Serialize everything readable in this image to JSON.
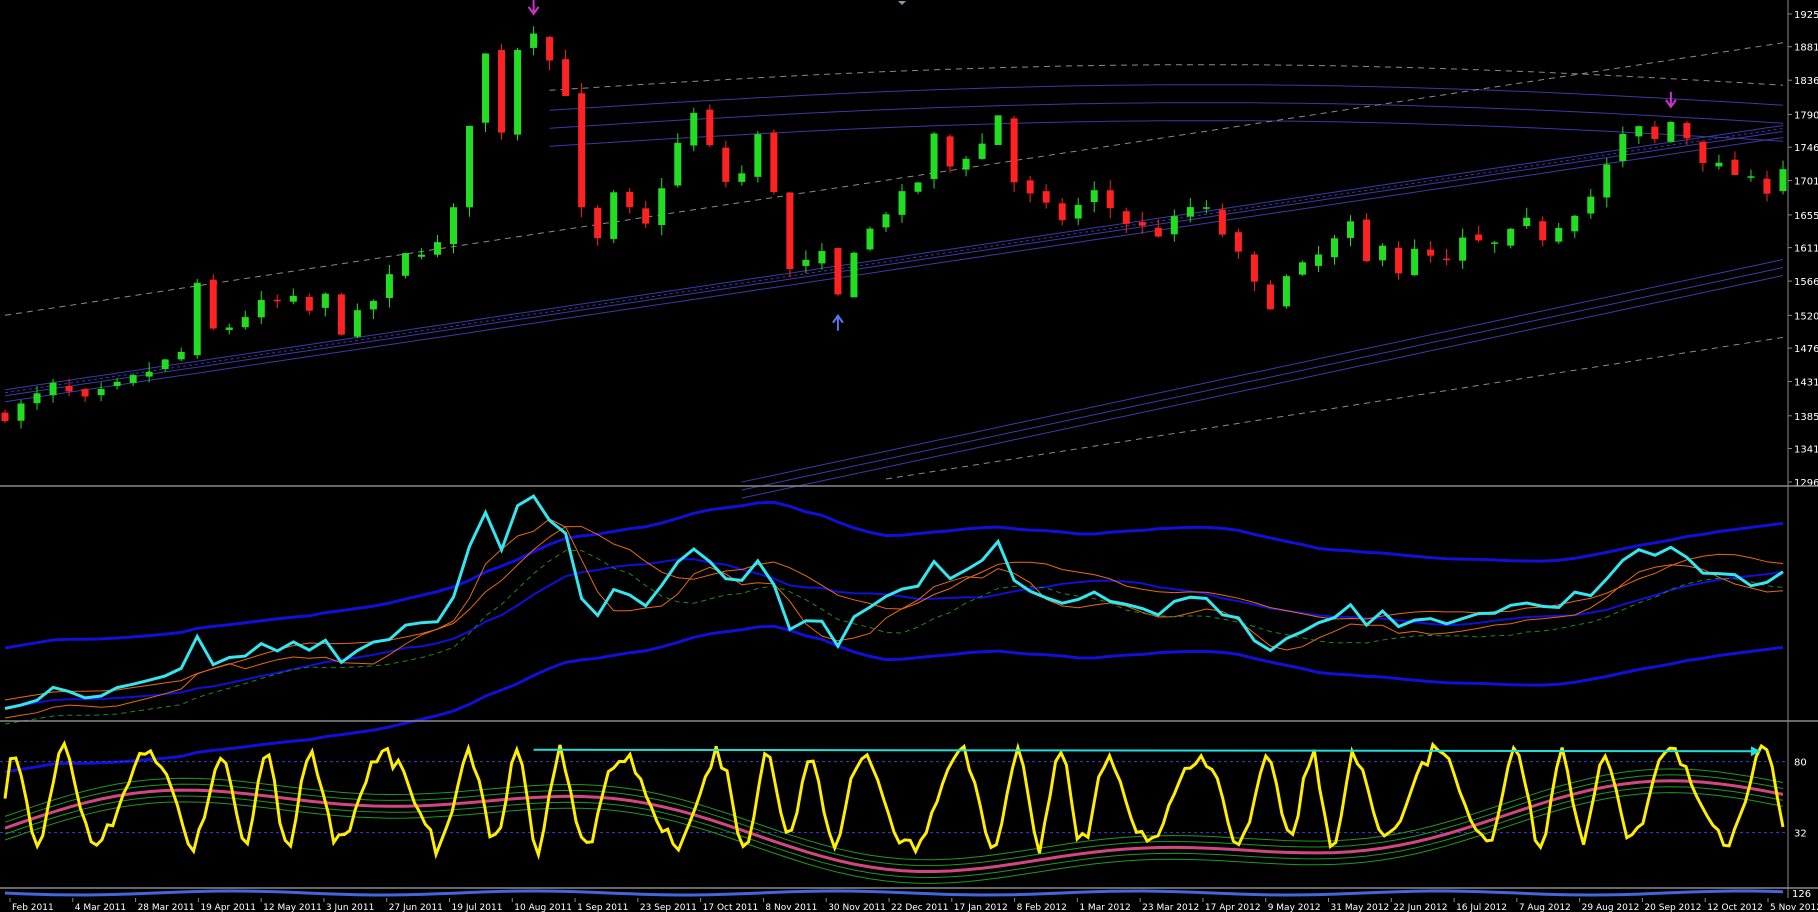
{
  "colors": {
    "background": "#000000",
    "separator": "#8a8a8a",
    "bull": "#22dd22",
    "bear": "#ff2222",
    "channel": "#3a3aa8",
    "channel_dark": "#2a2a80",
    "dash": "#8a8a8a",
    "osc_blue": "#1010d8",
    "osc_cyan": "#33e6f0",
    "osc_orange": "#e86a10",
    "osc_green": "#1e8a1e",
    "rsi_yellow": "#ffee00",
    "rsi_pink": "#d04880",
    "rsi_green": "#1e9a1e",
    "trend_cyan": "#22dddd",
    "arrow_magenta": "#cc33cc",
    "arrow_blue": "#5577ee",
    "level_blue": "#3b3bd8"
  },
  "chart_data": {
    "type": "candlestick",
    "title": "",
    "y_axis_ticks": [
      "1925",
      "1881",
      "1836",
      "1790",
      "1746",
      "1701",
      "1655",
      "1611",
      "1566",
      "1520",
      "1476",
      "1431",
      "1385",
      "1341",
      "1296"
    ],
    "ylim": [
      1296,
      1925
    ],
    "x_tick_labels": [
      "Feb 2011",
      "4 Mar 2011",
      "28 Mar 2011",
      "19 Apr 2011",
      "12 May 2011",
      "3 Jun 2011",
      "27 Jun 2011",
      "19 Jul 2011",
      "10 Aug 2011",
      "1 Sep 2011",
      "23 Sep 2011",
      "17 Oct 2011",
      "8 Nov 2011",
      "30 Nov 2011",
      "22 Dec 2011",
      "17 Jan 2012",
      "8 Feb 2012",
      "1 Mar 2012",
      "23 Mar 2012",
      "17 Apr 2012",
      "9 May 2012",
      "31 May 2012",
      "22 Jun 2012",
      "16 Jul 2012",
      "7 Aug 2012",
      "29 Aug 2012",
      "20 Sep 2012",
      "12 Oct 2012",
      "5 Nov 2012"
    ],
    "price_path": [
      [
        0,
        1385
      ],
      [
        3,
        1425
      ],
      [
        5,
        1405
      ],
      [
        7,
        1425
      ],
      [
        9,
        1445
      ],
      [
        11,
        1470
      ],
      [
        12,
        1558
      ],
      [
        13,
        1500
      ],
      [
        14,
        1505
      ],
      [
        16,
        1535
      ],
      [
        18,
        1540
      ],
      [
        19,
        1525
      ],
      [
        20,
        1545
      ],
      [
        21,
        1500
      ],
      [
        23,
        1540
      ],
      [
        25,
        1600
      ],
      [
        27,
        1615
      ],
      [
        28,
        1660
      ],
      [
        29,
        1780
      ],
      [
        30,
        1870
      ],
      [
        31,
        1770
      ],
      [
        32,
        1880
      ],
      [
        33,
        1905
      ],
      [
        35,
        1820
      ],
      [
        36,
        1660
      ],
      [
        37,
        1620
      ],
      [
        38,
        1680
      ],
      [
        40,
        1640
      ],
      [
        42,
        1750
      ],
      [
        43,
        1790
      ],
      [
        45,
        1700
      ],
      [
        46,
        1710
      ],
      [
        47,
        1760
      ],
      [
        48,
        1690
      ],
      [
        49,
        1580
      ],
      [
        51,
        1600
      ],
      [
        52,
        1545
      ],
      [
        53,
        1610
      ],
      [
        55,
        1660
      ],
      [
        57,
        1700
      ],
      [
        58,
        1760
      ],
      [
        59,
        1720
      ],
      [
        61,
        1750
      ],
      [
        62,
        1790
      ],
      [
        63,
        1700
      ],
      [
        64,
        1680
      ],
      [
        66,
        1650
      ],
      [
        68,
        1685
      ],
      [
        70,
        1645
      ],
      [
        72,
        1630
      ],
      [
        74,
        1665
      ],
      [
        75,
        1660
      ],
      [
        77,
        1600
      ],
      [
        78,
        1560
      ],
      [
        79,
        1535
      ],
      [
        80,
        1570
      ],
      [
        82,
        1600
      ],
      [
        84,
        1640
      ],
      [
        85,
        1590
      ],
      [
        86,
        1620
      ],
      [
        87,
        1580
      ],
      [
        88,
        1605
      ],
      [
        90,
        1590
      ],
      [
        91,
        1620
      ],
      [
        93,
        1615
      ],
      [
        95,
        1645
      ],
      [
        96,
        1625
      ],
      [
        98,
        1660
      ],
      [
        99,
        1680
      ],
      [
        100,
        1720
      ],
      [
        101,
        1760
      ],
      [
        102,
        1770
      ],
      [
        103,
        1755
      ],
      [
        104,
        1780
      ],
      [
        105,
        1760
      ],
      [
        106,
        1730
      ],
      [
        108,
        1710
      ],
      [
        109,
        1700
      ],
      [
        110,
        1690
      ],
      [
        111,
        1720
      ]
    ],
    "annotations": [
      {
        "type": "down-arrow",
        "index": 33
      },
      {
        "type": "up-arrow",
        "index": 52
      },
      {
        "type": "down-arrow",
        "index": 104
      }
    ],
    "oscillator_2_levels": [
      "80",
      "32"
    ],
    "oscillator_3_label": "126"
  }
}
